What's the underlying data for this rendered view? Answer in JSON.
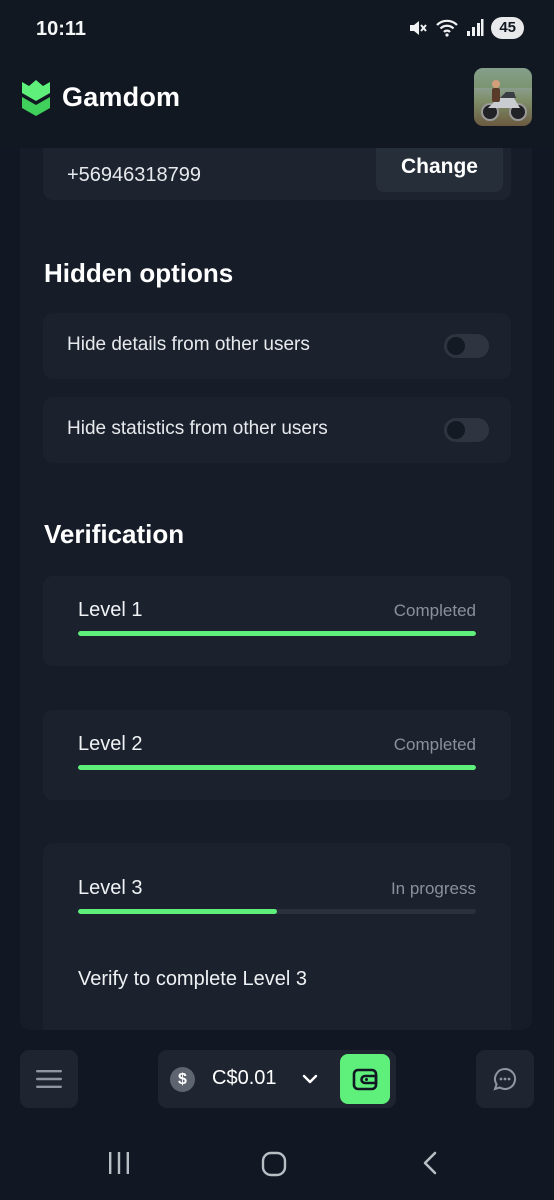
{
  "status_bar": {
    "time": "10:11",
    "battery": "45",
    "icons": [
      "mute-icon",
      "wifi-icon",
      "signal-icon",
      "battery-icon"
    ]
  },
  "header": {
    "app_name": "Gamdom",
    "logo_icon": "gamdom-castle-logo",
    "avatar": "user-avatar-photo"
  },
  "phone": {
    "number": "+56946318799",
    "change_label": "Change"
  },
  "hidden_options": {
    "title": "Hidden options",
    "items": [
      {
        "label": "Hide details from other users",
        "enabled": false
      },
      {
        "label": "Hide statistics from other users",
        "enabled": false
      }
    ]
  },
  "verification": {
    "title": "Verification",
    "levels": [
      {
        "name": "Level 1",
        "status": "Completed",
        "progress": 1.0
      },
      {
        "name": "Level 2",
        "status": "Completed",
        "progress": 1.0
      },
      {
        "name": "Level 3",
        "status": "In progress",
        "progress": 0.5,
        "hint": "Verify to complete Level 3"
      }
    ]
  },
  "bottom_bar": {
    "balance": "C$0.01",
    "currency_icon": "dollar-icon",
    "menu_icon": "hamburger-menu-icon",
    "wallet_icon": "wallet-icon",
    "chat_icon": "chat-bubble-icon"
  },
  "nav_bar": {
    "buttons": [
      "recent-apps-icon",
      "home-icon",
      "back-icon"
    ]
  },
  "colors": {
    "accent_green": "#5ef07a",
    "background": "#111823",
    "card": "#1b222d",
    "muted_text": "#8a919d"
  }
}
